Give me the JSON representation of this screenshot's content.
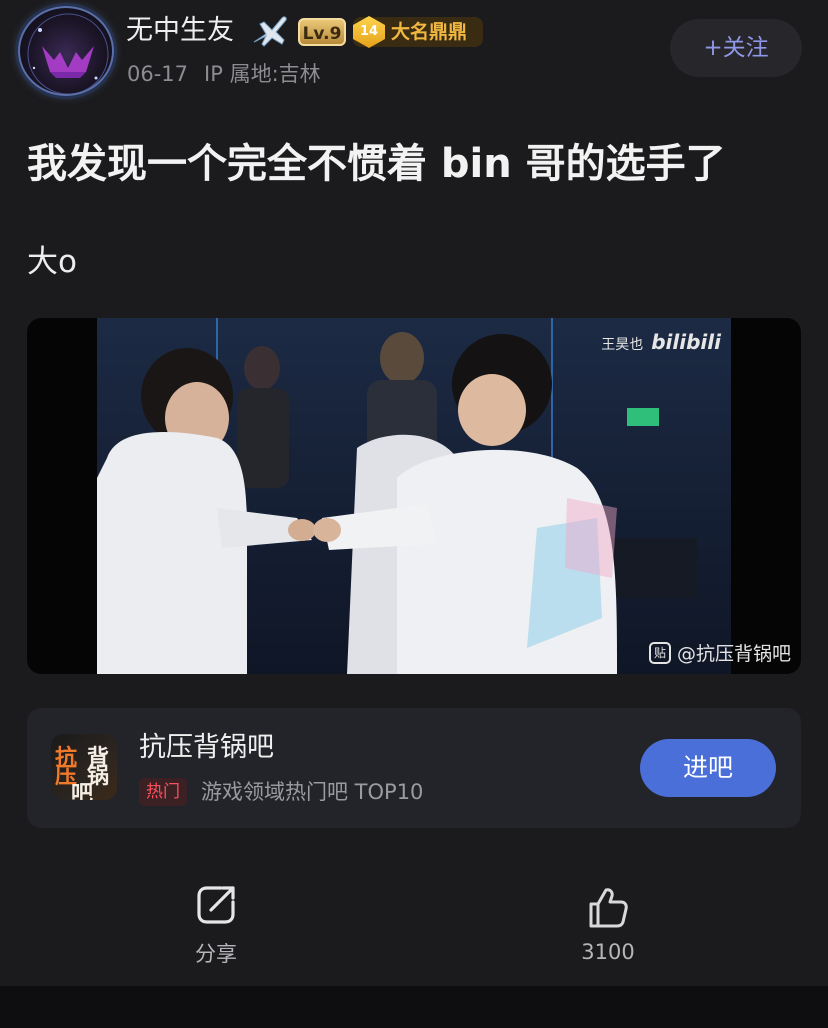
{
  "author": {
    "name": "无中生友",
    "level": "Lv.9",
    "rank_level": "14",
    "rank_title": "大名鼎鼎",
    "date": "06-17",
    "ip_location": "IP 属地:吉林",
    "follow_label": "+关注"
  },
  "post": {
    "title": "我发现一个完全不惯着 bin 哥的选手了",
    "body": "大o"
  },
  "media": {
    "watermark_top_name": "王昊也",
    "watermark_top_brand": "bilibili",
    "tieba_mark": "贴",
    "watermark_bottom": "@抗压背锅吧"
  },
  "forum": {
    "name": "抗压背锅吧",
    "avatar_chars": [
      "抗",
      "背",
      "压",
      "锅",
      "吧"
    ],
    "hot_tag": "热门",
    "description": "游戏领域热门吧 TOP10",
    "enter_label": "进吧"
  },
  "actions": {
    "share_label": "分享",
    "like_count": "3100"
  },
  "colors": {
    "background": "#1b1b1d",
    "accent_blue": "#4a6fd8",
    "follow_text": "#8f97e8",
    "hot_red": "#ff4e5d",
    "rank_gold": "#f0b840"
  },
  "icons": [
    "plane-emoji-icon",
    "share-icon",
    "thumbs-up-icon"
  ]
}
